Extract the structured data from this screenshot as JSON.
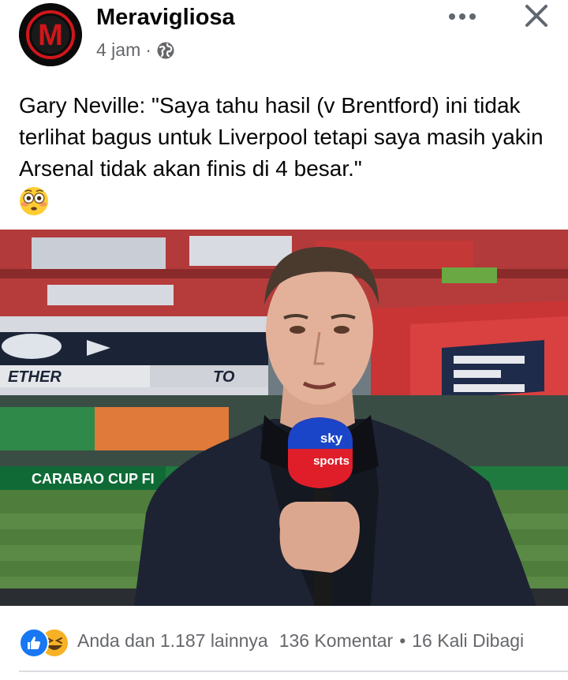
{
  "post": {
    "page_name": "Meravigliosa",
    "timestamp": "4 jam",
    "separator": "·",
    "audience_icon": "globe-icon",
    "logo_letter": "M",
    "text": "Gary Neville: \"Saya tahu hasil (v Brentford) ini tidak terlihat bagus untuk Liverpool tetapi saya masih yakin Arsenal tidak akan finis di 4 besar.\"",
    "emoji": "flushed-face"
  },
  "photo": {
    "banner_text": "CARABAO CUP FI",
    "mic_brand_top": "sky",
    "mic_brand_bottom": "sports",
    "stand_text_left": "ETHER",
    "stand_text_mid": "TO"
  },
  "footer": {
    "reactions_text": "Anda dan 1.187 lainnya",
    "comments_text": "136 Komentar",
    "dot": "•",
    "shares_text": "16 Kali Dibagi"
  },
  "colors": {
    "logo_red": "#d0161b",
    "meta_gray": "#65676b",
    "like_blue": "#1877f2",
    "haha_yellow": "#f7b125"
  }
}
